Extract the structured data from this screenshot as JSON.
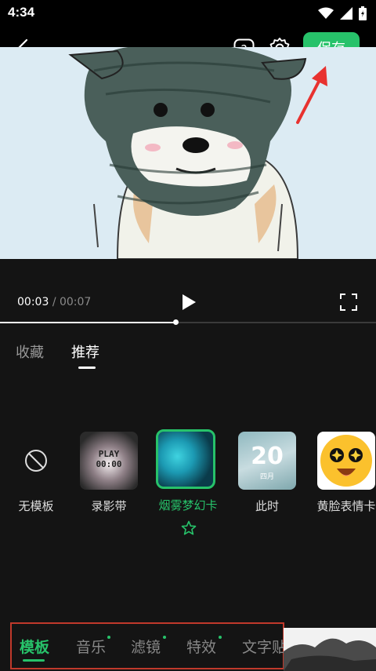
{
  "status_bar": {
    "time": "4:34"
  },
  "toolbar": {
    "save_label": "保存"
  },
  "player": {
    "current_time": "00:03",
    "separator": "/",
    "total_time": "00:07",
    "progress": 0.47
  },
  "tabs": [
    {
      "label": "收藏"
    },
    {
      "label": "推荐"
    }
  ],
  "templates": [
    {
      "label": "无模板"
    },
    {
      "label": "录影带",
      "thumb_text": "PLAY\n00:00"
    },
    {
      "label": "烟雾梦幻卡"
    },
    {
      "label": "此时",
      "thumb_number": "20",
      "thumb_month": "四月"
    },
    {
      "label": "黄脸表情卡"
    }
  ],
  "bottom_nav": [
    {
      "label": "模板"
    },
    {
      "label": "音乐"
    },
    {
      "label": "滤镜"
    },
    {
      "label": "特效"
    },
    {
      "label": "文字贴"
    }
  ],
  "colors": {
    "accent": "#27c26a",
    "annotation": "#e8322f",
    "highlight_box": "#c0392b"
  }
}
